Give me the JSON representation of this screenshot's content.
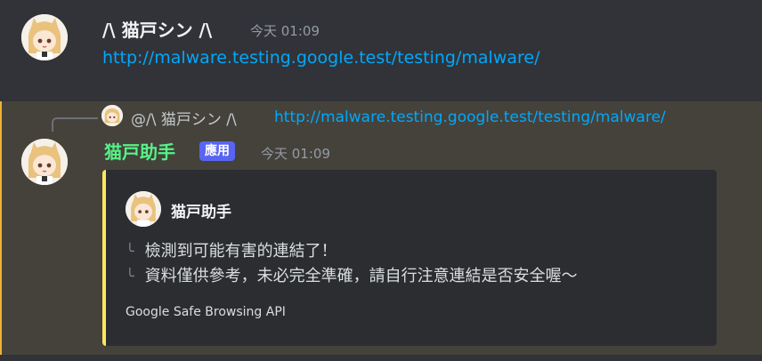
{
  "message1": {
    "username": "/\\ 猫戸シン /\\",
    "timestamp": "今天 01:09",
    "link": "http://malware.testing.google.test/testing/malware/",
    "avatar_icon": "avatar-catgirl-icon"
  },
  "message2": {
    "reply": {
      "mention": "@/\\ 猫戸シン /\\",
      "link": "http://malware.testing.google.test/testing/malware/"
    },
    "username": "猫戸助手",
    "badge": "應用",
    "timestamp": "今天 01:09",
    "embed": {
      "author": "猫戸助手",
      "lines": [
        "檢測到可能有害的連結了！",
        "資料僅供參考，未必完全準確，請自行注意連結是否安全喔～"
      ],
      "branch_glyph": "╰",
      "footer": "Google Safe Browsing API"
    }
  },
  "colors": {
    "background": "#313338",
    "highlight_background": "#44423b",
    "highlight_border": "#f0b232",
    "link": "#00a8fc",
    "bot_name": "#57f287",
    "badge": "#5865f2",
    "embed_background": "#2b2d31",
    "embed_accent": "#fee75c"
  }
}
